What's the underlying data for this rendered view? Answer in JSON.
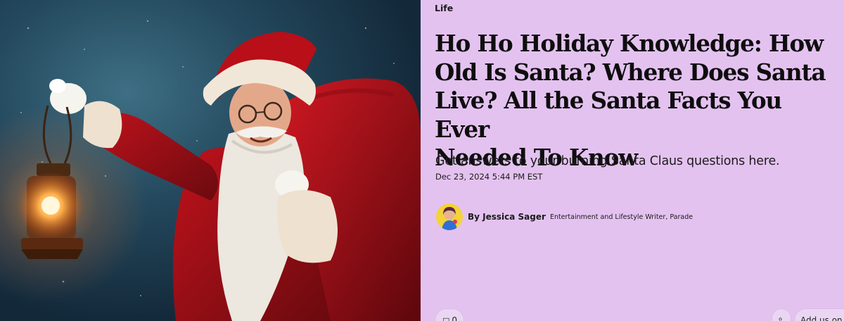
{
  "hero": {
    "icon": "santa-photo"
  },
  "article": {
    "category": "Life",
    "headline_lines": [
      "Ho Ho Holiday Knowledge: How",
      "Old Is Santa? Where Does Santa",
      "Live? All the Santa Facts You Ever",
      "Needed To Know"
    ],
    "dek": "Get answers to your burning Santa Claus questions here.",
    "date": "Dec 23, 2024 5:44 PM EST",
    "author": {
      "byline": "By Jessica Sager",
      "role": "Entertainment and Lifestyle Writer, Parade",
      "avatar_icon": "author-avatar"
    }
  },
  "actions": {
    "comments_count": "0",
    "comments_icon": "comment-icon",
    "share_icon": "share-icon",
    "follow_label": "Add us on"
  },
  "colors": {
    "panel_background": "#e4c2f0",
    "headline": "#0e0e0e"
  }
}
